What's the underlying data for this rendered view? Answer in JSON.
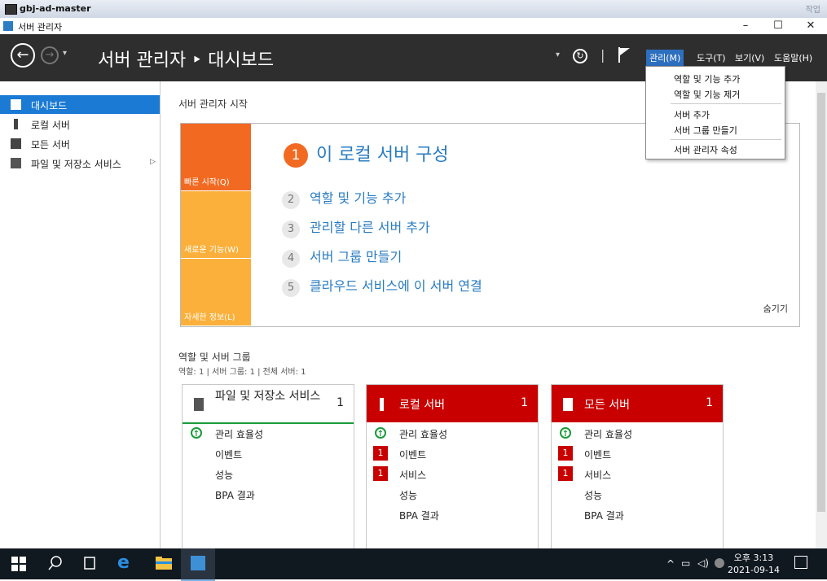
{
  "vm": {
    "title": "gbj-ad-master",
    "right_label": "작업"
  },
  "window": {
    "title": "서버 관리자",
    "min": "–",
    "max": "☐",
    "close": "✕"
  },
  "header": {
    "breadcrumb": "서버 관리자 ‣ 대시보드",
    "refresh_sep": "|",
    "menus": [
      "관리(M)",
      "도구(T)",
      "보기(V)",
      "도움말(H)"
    ]
  },
  "dropdown": {
    "items": [
      "역할 및 기능 추가",
      "역할 및 기능 제거",
      "서버 추가",
      "서버 그룹 만들기",
      "서버 관리자 속성"
    ]
  },
  "sidebar": {
    "items": [
      {
        "label": "대시보드"
      },
      {
        "label": "로컬 서버"
      },
      {
        "label": "모든 서버"
      },
      {
        "label": "파일 및 저장소 서비스",
        "arrow": "▷"
      }
    ]
  },
  "quickstart": {
    "title": "서버 관리자 시작",
    "tiles": [
      "빠른 시작(Q)",
      "새로운 기능(W)",
      "자세한 정보(L)"
    ],
    "step1": {
      "num": "1",
      "label": "이 로컬 서버 구성"
    },
    "steps": [
      {
        "num": "2",
        "label": "역할 및 기능 추가"
      },
      {
        "num": "3",
        "label": "관리할 다른 서버 추가"
      },
      {
        "num": "4",
        "label": "서버 그룹 만들기"
      },
      {
        "num": "5",
        "label": "클라우드 서비스에 이 서버 연결"
      }
    ],
    "hide": "숨기기"
  },
  "roles": {
    "title": "역할 및 서버 그룹",
    "subtitle": "역할: 1  |  서버 그룹: 1  |  전체 서버: 1",
    "cards": [
      {
        "name": "파일 및 저장소 서비스",
        "count": "1",
        "rows": [
          "관리 효율성",
          "이벤트",
          "성능",
          "BPA 결과"
        ]
      },
      {
        "name": "로컬 서버",
        "count": "1",
        "rows": [
          "관리 효율성",
          "이벤트",
          "서비스",
          "성능",
          "BPA 결과"
        ],
        "badges": [
          "1",
          "1"
        ]
      },
      {
        "name": "모든 서버",
        "count": "1",
        "rows": [
          "관리 효율성",
          "이벤트",
          "서비스",
          "성능",
          "BPA 결과"
        ],
        "badges": [
          "1",
          "1"
        ]
      }
    ]
  },
  "taskbar": {
    "time": "오후 3:13",
    "date": "2021-09-14"
  },
  "colors": {
    "header": "#2e2e2e",
    "accent": "#1a7ad4",
    "quickstart_orange": "#f26a21",
    "tile_yellow": "#fbb03b",
    "alert_red": "#c90000"
  }
}
